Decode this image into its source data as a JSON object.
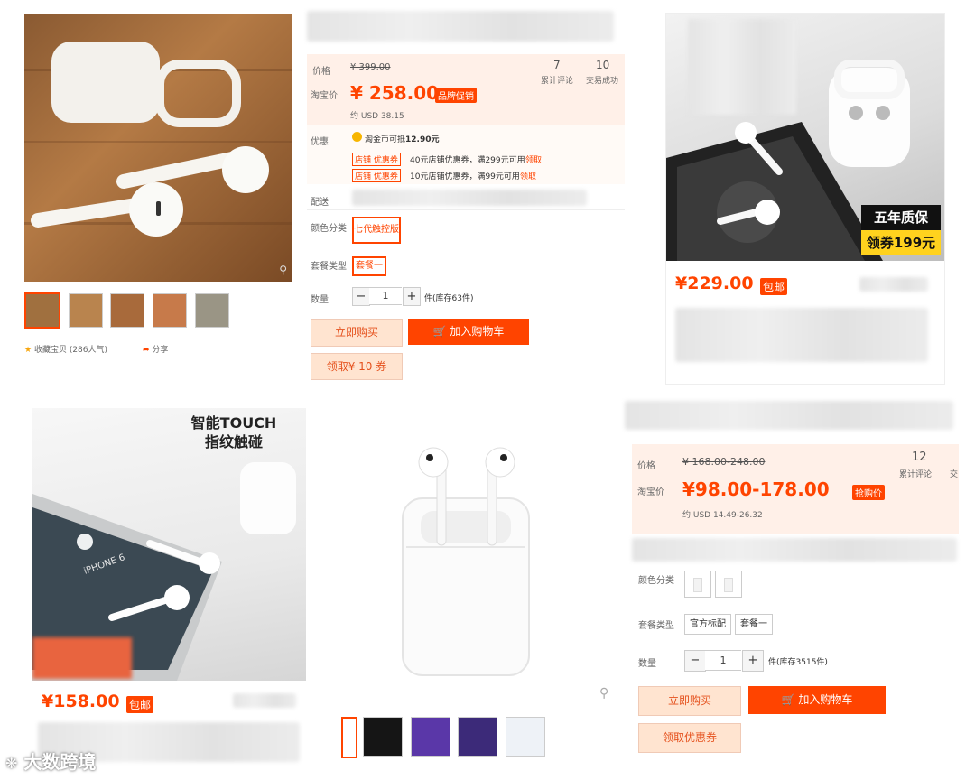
{
  "p1": {
    "label_price": "价格",
    "original_price": "¥ 399.00",
    "label_taobao": "淘宝价",
    "price": "¥ 258.00",
    "price_tag": "品牌促销",
    "usd": "约 USD 38.15",
    "stat1_value": "7",
    "stat1_label": "累计评论",
    "stat2_value": "10",
    "stat2_label": "交易成功",
    "label_discount": "优惠",
    "coin_text": "淘金币可抵",
    "coin_amount": "12.90元",
    "coupon_tag": "店铺 优惠券",
    "coupon1_text": "40元店铺优惠券，满299元可用",
    "coupon2_text": "10元店铺优惠券，满99元可用",
    "coupon_claim": "领取",
    "label_ship": "配送",
    "label_color": "颜色分类",
    "color_option": "七代触控版",
    "label_package": "套餐类型",
    "package_option": "套餐一",
    "label_qty": "数量",
    "qty_minus": "−",
    "qty_value": "1",
    "qty_plus": "+",
    "stock": "件(库存63件)",
    "buy_now": "立即购买",
    "add_cart": "加入购物车",
    "claim_coupon": "领取¥ 10 券",
    "favorite": "收藏宝贝 (286人气)",
    "share": "分享"
  },
  "p2": {
    "promo_line1": "五年质保",
    "promo_line2": "领券199元",
    "price": "¥229.00",
    "tag": "包邮"
  },
  "p3": {
    "headline1": "智能TOUCH",
    "headline2": "指纹触碰",
    "phone_label": "iPHONE 6",
    "price": "¥158.00",
    "tag": "包邮"
  },
  "p5": {
    "label_price": "价格",
    "original_price": "¥ 168.00-248.00",
    "label_taobao": "淘宝价",
    "price": "¥98.00-178.00",
    "price_tag": "抢购价",
    "usd": "约 USD 14.49-26.32",
    "stat_value": "12",
    "stat_label": "累计评论",
    "stat2_label": "交",
    "label_color": "颜色分类",
    "label_package": "套餐类型",
    "package_option1": "官方标配",
    "package_option2": "套餐一",
    "label_qty": "数量",
    "qty_minus": "−",
    "qty_value": "1",
    "qty_plus": "+",
    "stock": "件(库存3515件)",
    "buy_now": "立即购买",
    "add_cart": "加入购物车",
    "claim_coupon": "领取优惠券"
  },
  "watermark": "大数跨境",
  "colors": {
    "accent": "#ff4400",
    "price_band": "#fff0e8",
    "promo_yellow": "#ffd21e"
  }
}
